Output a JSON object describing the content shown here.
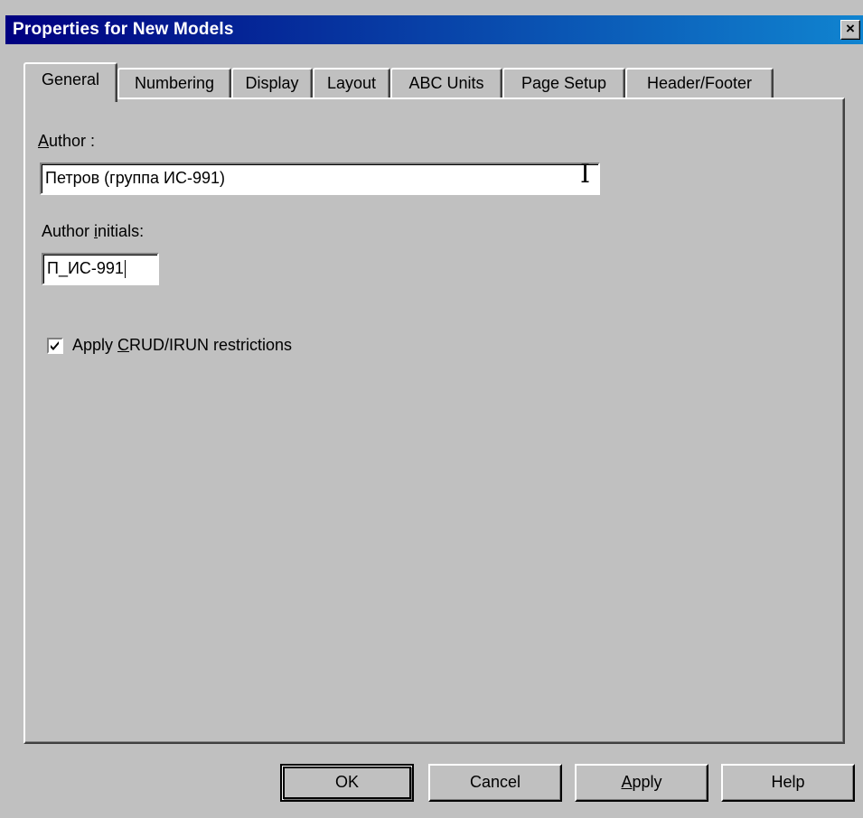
{
  "window": {
    "title": "Properties for New Models",
    "close_label": "×"
  },
  "tabs": [
    {
      "label": "General",
      "active": true
    },
    {
      "label": "Numbering",
      "active": false
    },
    {
      "label": "Display",
      "active": false
    },
    {
      "label": "Layout",
      "active": false
    },
    {
      "label": "ABC Units",
      "active": false
    },
    {
      "label": "Page Setup",
      "active": false
    },
    {
      "label": "Header/Footer",
      "active": false
    }
  ],
  "general": {
    "author_label_mnemonic": "A",
    "author_label_rest": "uthor :",
    "author_value": "Петров (группа ИС-991)",
    "initials_label_pre": "Author ",
    "initials_label_mnemonic": "i",
    "initials_label_rest": "nitials:",
    "initials_value": "П_ИС-991",
    "crud_checked": true,
    "crud_label_pre": "Apply ",
    "crud_label_mnemonic": "C",
    "crud_label_rest": "RUD/IRUN restrictions"
  },
  "buttons": {
    "ok": "OK",
    "cancel": "Cancel",
    "apply_mnemonic": "A",
    "apply_rest": "pply",
    "help": "Help"
  }
}
